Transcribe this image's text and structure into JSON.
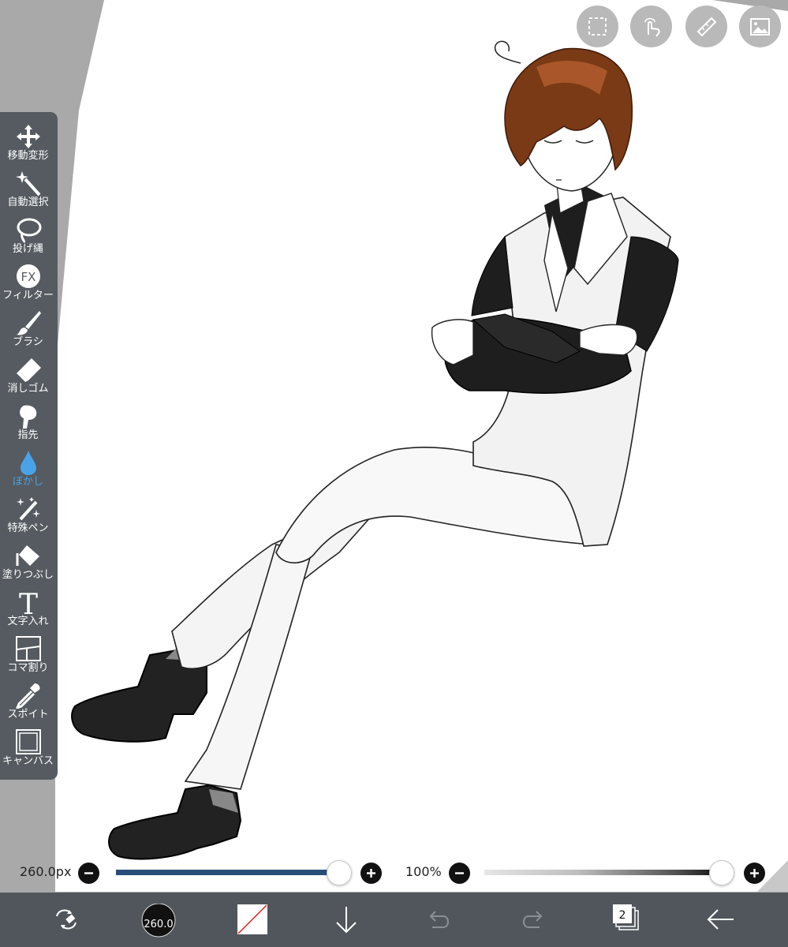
{
  "toolbar": {
    "tools": [
      {
        "label": "移動変形",
        "icon": "move-icon"
      },
      {
        "label": "自動選択",
        "icon": "magic-wand-icon"
      },
      {
        "label": "投げ縄",
        "icon": "lasso-icon"
      },
      {
        "label": "フィルター",
        "icon": "fx-icon",
        "icon_text": "FX"
      },
      {
        "label": "ブラシ",
        "icon": "brush-icon"
      },
      {
        "label": "消しゴム",
        "icon": "eraser-icon"
      },
      {
        "label": "指先",
        "icon": "finger-icon"
      },
      {
        "label": "ぼかし",
        "icon": "blur-drop-icon",
        "active": true
      },
      {
        "label": "特殊ペン",
        "icon": "special-pen-icon"
      },
      {
        "label": "塗りつぶし",
        "icon": "fill-bucket-icon"
      },
      {
        "label": "文字入れ",
        "icon": "text-icon",
        "icon_text": "T"
      },
      {
        "label": "コマ割り",
        "icon": "panel-split-icon"
      },
      {
        "label": "スポイト",
        "icon": "eyedropper-icon"
      },
      {
        "label": "キャンバス",
        "icon": "canvas-icon"
      }
    ]
  },
  "topbar": {
    "buttons": [
      "selection-icon",
      "touch-gesture-icon",
      "ruler-icon",
      "reference-image-icon"
    ]
  },
  "brush_size": {
    "value": "260.0px",
    "level": 0.95,
    "minus_icon": "minus-icon",
    "plus_icon": "plus-icon"
  },
  "opacity": {
    "value": "100%",
    "level": 1.0
  },
  "bottombar": {
    "brush_preview_value": "260.0",
    "layer_count": "2",
    "icons": [
      "transform-swap-icon",
      "brush-size-preview-icon",
      "color-swatch-icon",
      "import-arrow-icon",
      "undo-icon",
      "redo-icon",
      "layers-icon",
      "back-arrow-icon"
    ]
  },
  "colors": {
    "toolbar_bg": "#555b60",
    "bottombar_bg": "#50565b",
    "accent_blue": "#4aa3e8",
    "slider_fill": "#284e78",
    "page_bg": "#a9a9a9",
    "canvas": "#ffffff"
  }
}
